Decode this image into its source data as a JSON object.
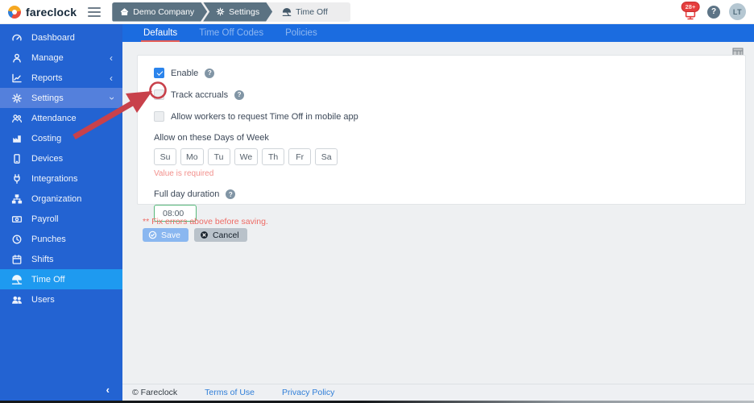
{
  "header": {
    "logo_text": "fareclock",
    "notification_badge": "28+",
    "help_glyph": "?",
    "avatar_initials": "LT",
    "breadcrumb": [
      {
        "label": "Demo Company"
      },
      {
        "label": "Settings"
      },
      {
        "label": "Time Off"
      }
    ]
  },
  "sidebar": {
    "items": [
      {
        "label": "Dashboard"
      },
      {
        "label": "Manage",
        "chevron": "‹"
      },
      {
        "label": "Reports",
        "chevron": "‹"
      },
      {
        "label": "Settings",
        "chevron": "‹",
        "expanded": true
      },
      {
        "label": "Attendance"
      },
      {
        "label": "Costing"
      },
      {
        "label": "Devices"
      },
      {
        "label": "Integrations"
      },
      {
        "label": "Organization"
      },
      {
        "label": "Payroll"
      },
      {
        "label": "Punches"
      },
      {
        "label": "Shifts"
      },
      {
        "label": "Time Off",
        "active": true
      },
      {
        "label": "Users"
      }
    ],
    "collapse_glyph": "‹"
  },
  "tabs": {
    "items": [
      {
        "label": "Defaults",
        "active": true
      },
      {
        "label": "Time Off Codes",
        "active": false
      },
      {
        "label": "Policies",
        "active": false
      }
    ]
  },
  "form": {
    "enable": {
      "label": "Enable",
      "checked": true
    },
    "track_accruals": {
      "label": "Track accruals",
      "checked": false
    },
    "mobile_request": {
      "label": "Allow workers to request Time Off in mobile app",
      "checked": false
    },
    "days_of_week": {
      "label": "Allow on these Days of Week",
      "days": [
        "Su",
        "Mo",
        "Tu",
        "We",
        "Th",
        "Fr",
        "Sa"
      ],
      "error": "Value is required"
    },
    "full_day_duration": {
      "label": "Full day duration",
      "value": "08:00"
    }
  },
  "actions": {
    "error_message": "** Fix errors above before saving.",
    "save_label": "Save",
    "cancel_label": "Cancel"
  },
  "footer": {
    "copyright": "© Fareclock",
    "links": [
      {
        "label": "Terms of Use"
      },
      {
        "label": "Privacy Policy"
      }
    ]
  },
  "colors": {
    "sidebar_blue": "#2363d2",
    "sidebar_active_blue": "#1e9af0",
    "sidebar_expanded_blue": "#5480dc",
    "tabbar_blue": "#1b6ce0",
    "tab_underline_red": "#e45c55",
    "checkbox_checked_blue": "#2b84ec",
    "duration_border_green": "#57b87b",
    "error_red": "#ee6a64",
    "annotation_red": "#c8414b",
    "link_blue": "#2f7ed8",
    "badge_red": "#e53e3e"
  }
}
